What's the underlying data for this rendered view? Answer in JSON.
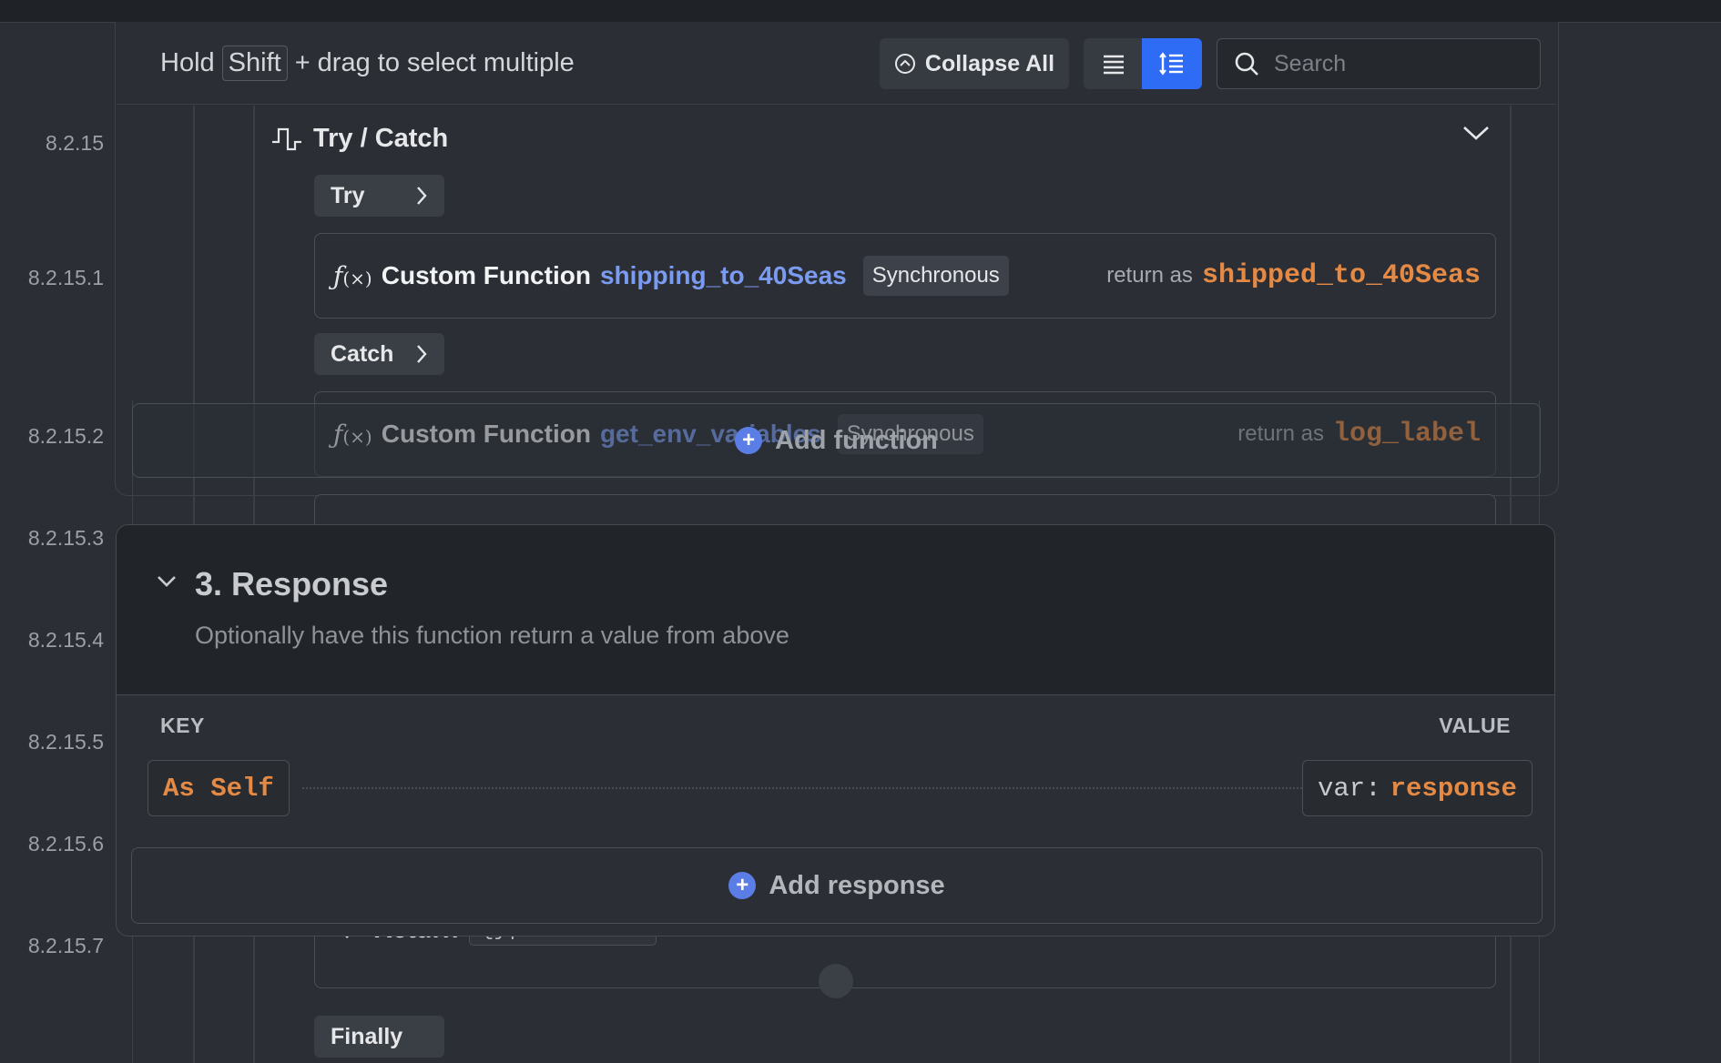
{
  "toolbar": {
    "hint_prefix": "Hold",
    "hint_key": "Shift",
    "hint_suffix": "+ drag to select multiple",
    "collapse_all_label": "Collapse All",
    "search_placeholder": "Search"
  },
  "line_numbers": [
    "8.2.15",
    "8.2.15.1",
    "8.2.15.2",
    "8.2.15.3",
    "8.2.15.4",
    "8.2.15.5",
    "8.2.15.6",
    "8.2.15.7"
  ],
  "try_catch": {
    "title": "Try / Catch",
    "try_label": "Try",
    "catch_label": "Catch",
    "finally_label": "Finally",
    "functions": [
      {
        "type_label": "Custom Function",
        "name": "shipping_to_40Seas",
        "mode": "Synchronous",
        "return_as_label": "return as",
        "return_var": "shipped_to_40Seas"
      },
      {
        "type_label": "Custom Function",
        "name": "get_env_variables",
        "mode": "Synchronous",
        "return_as_label": "return as",
        "return_var": "log_label"
      }
    ],
    "add_function_label": "Add function",
    "return_step": {
      "label": "Return",
      "filters": "{}|+2 filters"
    }
  },
  "response": {
    "title": "3. Response",
    "description": "Optionally have this function return a value from above",
    "key_header": "KEY",
    "value_header": "VALUE",
    "key_value": "As Self",
    "value_prefix": "var:",
    "value_name": "response",
    "add_response_label": "Add response"
  },
  "colors": {
    "accent_blue": "#2f6cf6",
    "function_name": "#7a9bf0",
    "variable_orange": "#e58a45"
  },
  "icons": [
    "collapse-circle-icon",
    "list-icon",
    "numbered-list-icon",
    "search-icon",
    "try-catch-icon",
    "chevron-down-icon",
    "chevron-right-icon",
    "function-icon",
    "plus-circle-icon",
    "arrow-left-icon"
  ]
}
